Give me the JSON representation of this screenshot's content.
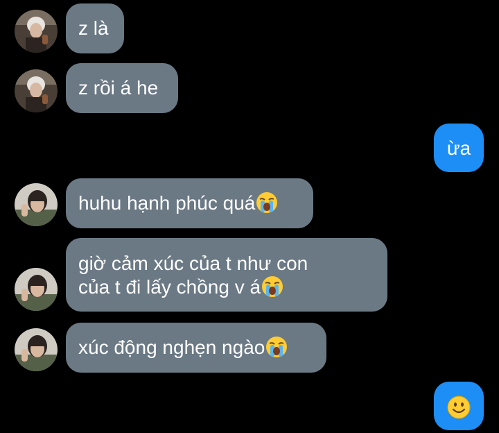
{
  "messages": [
    {
      "id": "m1",
      "direction": "incoming",
      "sender": "friend-a",
      "text": "z là",
      "emoji": null
    },
    {
      "id": "m2",
      "direction": "incoming",
      "sender": "friend-a",
      "text": "z rồi á he",
      "emoji": null
    },
    {
      "id": "m3",
      "direction": "outgoing",
      "text": "ừa",
      "emoji": null
    },
    {
      "id": "m4",
      "direction": "incoming",
      "sender": "friend-b",
      "text": "huhu hạnh phúc quá",
      "emoji": "loudly-crying-face"
    },
    {
      "id": "m5",
      "direction": "incoming",
      "sender": "friend-b",
      "line1": "giờ cảm xúc của t như con",
      "line2": "của t đi lấy chồng v á",
      "emoji": "loudly-crying-face"
    },
    {
      "id": "m6",
      "direction": "incoming",
      "sender": "friend-b",
      "text": "xúc động nghẹn ngào",
      "emoji": "loudly-crying-face"
    },
    {
      "id": "m7",
      "direction": "outgoing",
      "text": "",
      "emoji": "smiling-face"
    }
  ],
  "colors": {
    "background": "#000000",
    "incoming_bubble": "#6b7985",
    "outgoing_bubble": "#1d8ef5",
    "text": "#ffffff"
  }
}
